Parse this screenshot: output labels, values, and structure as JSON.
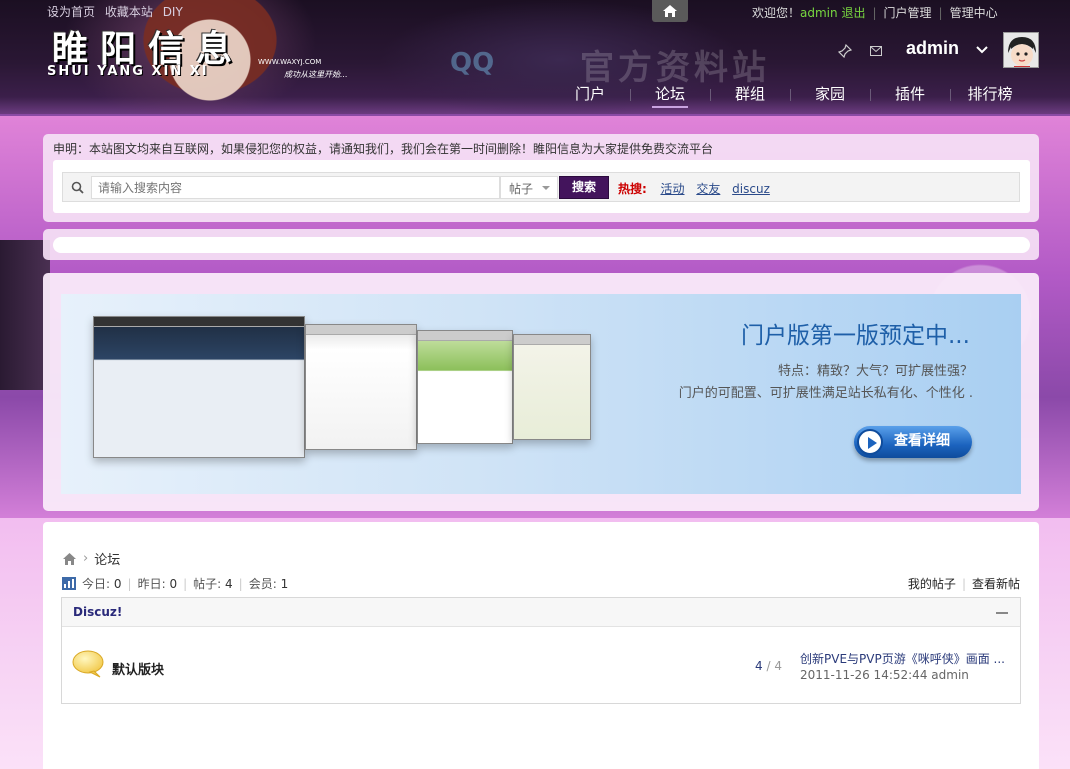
{
  "top_links": [
    "设为首页",
    "收藏本站",
    "DIY"
  ],
  "logo": {
    "title": "睢阳信息",
    "subtitle": "SHUI YANG XIN XI",
    "url": "WWW.WAXYJ.COM",
    "slogan": "成功从这里开始..."
  },
  "watermark": "官方资料站",
  "userbar": {
    "welcome": "欢迎您！",
    "username": "admin",
    "logout": "退出",
    "portal_admin": "门户管理",
    "admin_center": "管理中心"
  },
  "profile_name": "admin",
  "nav": [
    {
      "label": "门户",
      "active": false
    },
    {
      "label": "论坛",
      "active": true
    },
    {
      "label": "群组",
      "active": false
    },
    {
      "label": "家园",
      "active": false
    },
    {
      "label": "插件",
      "active": false
    },
    {
      "label": "排行榜",
      "active": false
    }
  ],
  "notice": "申明：本站图文均来自互联网，如果侵犯您的权益，请通知我们，我们会在第一时间删除！睢阳信息为大家提供免费交流平台",
  "search": {
    "placeholder": "请输入搜索内容",
    "type": "帖子",
    "button": "搜索",
    "hot_label": "热搜:",
    "hot_links": [
      "活动",
      "交友",
      "discuz"
    ]
  },
  "banner": {
    "title": "门户版第一版预定中...",
    "line1": "特点：精致？大气？可扩展性强？",
    "line2": "门户的可配置、可扩展性满足站长私有化、个性化 .",
    "button": "查看详细"
  },
  "breadcrumb": {
    "current": "论坛"
  },
  "stats": {
    "today_label": "今日:",
    "today": "0",
    "yesterday_label": "昨日:",
    "yesterday": "0",
    "posts_label": "帖子:",
    "posts": "4",
    "members_label": "会员:",
    "members": "1"
  },
  "my_links": {
    "my_posts": "我的帖子",
    "new_posts": "查看新帖"
  },
  "forum": {
    "category": "Discuz!",
    "board_name": "默认版块",
    "threads": "4",
    "posts": "/ 4",
    "last_post_title": "创新PVE与PVP页游《咪呼侠》画面 ...",
    "last_post_time": "2011-11-26 14:52:44",
    "last_post_author": "admin"
  },
  "colors": {
    "header_bg": "#2a1734",
    "nav_accent": "#c9a3e0",
    "search_button": "#43145c",
    "hot_label": "#cc0000",
    "banner_title": "#1e5fa8"
  }
}
